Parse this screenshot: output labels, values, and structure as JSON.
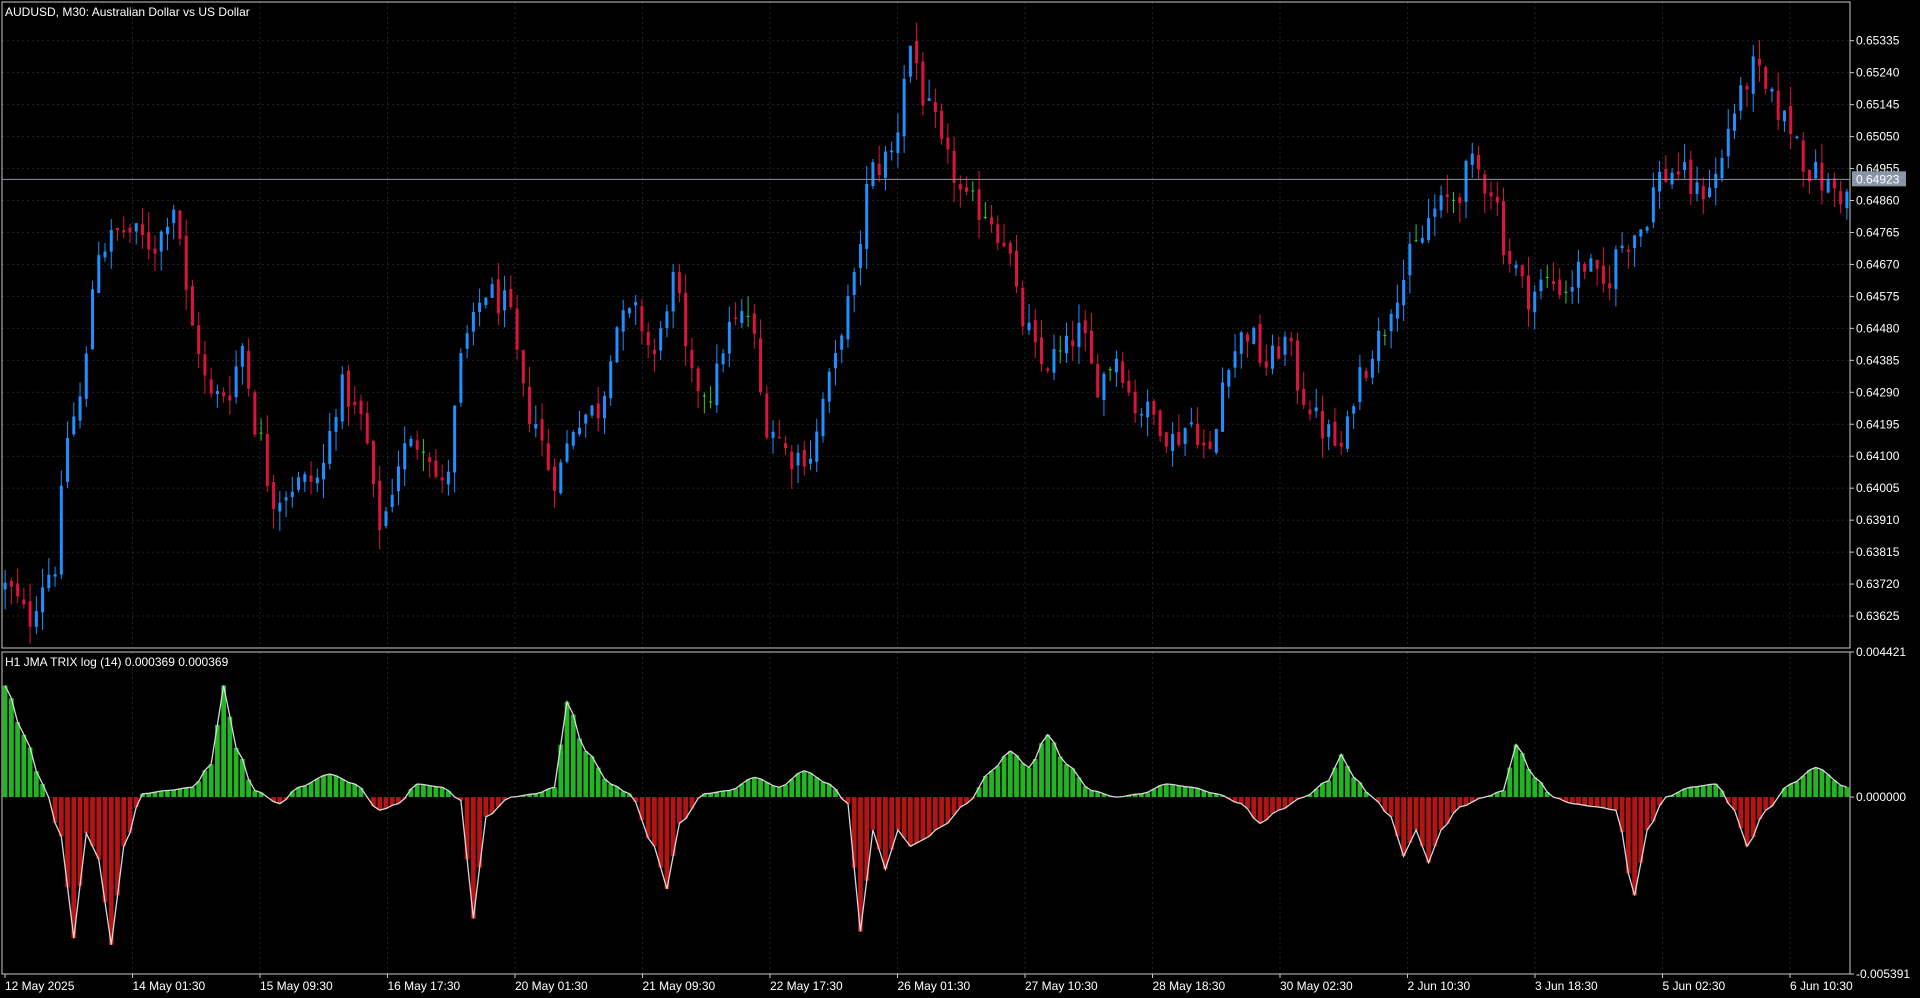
{
  "symbol_title": "AUDUSD, M30:  Australian Dollar vs US Dollar",
  "indicator_title": "H1 JMA TRIX log (14) 0.000369 0.000369",
  "current_price_label": "0.64923",
  "colors": {
    "background": "#000000",
    "frame": "#c8c8c8",
    "grid": "#1e2230",
    "bull_candle": "#1e90ff",
    "bear_candle": "#dc143c",
    "neutral_candle": "#32cd32",
    "trix_positive": "#22b422",
    "trix_negative": "#b41414",
    "trix_line": "#d8d8d8",
    "price_line": "#8a95a8",
    "price_tag_bg": "#8a95a8"
  },
  "chart_data": [
    {
      "type": "candlestick",
      "title": "AUDUSD, M30:  Australian Dollar vs US Dollar",
      "y_ticks": [
        "0.65335",
        "0.65240",
        "0.65145",
        "0.65050",
        "0.64955",
        "0.64860",
        "0.64765",
        "0.64670",
        "0.64575",
        "0.64480",
        "0.64385",
        "0.64290",
        "0.64195",
        "0.64100",
        "0.64005",
        "0.63910",
        "0.63815",
        "0.63720",
        "0.63625"
      ],
      "ylim": [
        0.6353,
        0.6545
      ],
      "current_price": 0.64923,
      "series": [
        {
          "name": "close",
          "waypoints": [
            [
              0,
              0.6371
            ],
            [
              4,
              0.6362
            ],
            [
              6,
              0.6373
            ],
            [
              8,
              0.6378
            ],
            [
              10,
              0.6416
            ],
            [
              12,
              0.6427
            ],
            [
              15,
              0.6472
            ],
            [
              19,
              0.6477
            ],
            [
              24,
              0.6473
            ],
            [
              27,
              0.6485
            ],
            [
              30,
              0.6448
            ],
            [
              33,
              0.6427
            ],
            [
              36,
              0.643
            ],
            [
              38,
              0.6443
            ],
            [
              40,
              0.642
            ],
            [
              43,
              0.6398
            ],
            [
              47,
              0.6402
            ],
            [
              50,
              0.6403
            ],
            [
              54,
              0.643
            ],
            [
              57,
              0.6421
            ],
            [
              60,
              0.639
            ],
            [
              64,
              0.6412
            ],
            [
              67,
              0.6415
            ],
            [
              70,
              0.64
            ],
            [
              74,
              0.6445
            ],
            [
              77,
              0.6459
            ],
            [
              80,
              0.6455
            ],
            [
              84,
              0.6423
            ],
            [
              88,
              0.6404
            ],
            [
              92,
              0.6422
            ],
            [
              95,
              0.6424
            ],
            [
              98,
              0.6449
            ],
            [
              101,
              0.6452
            ],
            [
              104,
              0.644
            ],
            [
              107,
              0.6462
            ],
            [
              110,
              0.6432
            ],
            [
              113,
              0.6429
            ],
            [
              116,
              0.6448
            ],
            [
              119,
              0.6452
            ],
            [
              122,
              0.642
            ],
            [
              126,
              0.641
            ],
            [
              129,
              0.6411
            ],
            [
              132,
              0.6432
            ],
            [
              135,
              0.6455
            ],
            [
              139,
              0.6495
            ],
            [
              142,
              0.65
            ],
            [
              145,
              0.6532
            ],
            [
              148,
              0.6512
            ],
            [
              151,
              0.6497
            ],
            [
              154,
              0.6485
            ],
            [
              157,
              0.6483
            ],
            [
              160,
              0.6475
            ],
            [
              163,
              0.645
            ],
            [
              166,
              0.6437
            ],
            [
              169,
              0.644
            ],
            [
              172,
              0.6447
            ],
            [
              175,
              0.6432
            ],
            [
              178,
              0.644
            ],
            [
              181,
              0.6425
            ],
            [
              184,
              0.6422
            ],
            [
              187,
              0.6415
            ],
            [
              190,
              0.642
            ],
            [
              193,
              0.641
            ],
            [
              196,
              0.644
            ],
            [
              199,
              0.6447
            ],
            [
              202,
              0.6437
            ],
            [
              205,
              0.6444
            ],
            [
              208,
              0.6428
            ],
            [
              211,
              0.6418
            ],
            [
              214,
              0.6412
            ],
            [
              217,
              0.6435
            ],
            [
              220,
              0.6445
            ],
            [
              223,
              0.646
            ],
            [
              226,
              0.6472
            ],
            [
              229,
              0.6483
            ],
            [
              232,
              0.6487
            ],
            [
              235,
              0.6496
            ],
            [
              238,
              0.649
            ],
            [
              241,
              0.6468
            ],
            [
              244,
              0.6458
            ],
            [
              247,
              0.6462
            ],
            [
              250,
              0.646
            ],
            [
              253,
              0.6467
            ],
            [
              256,
              0.646
            ],
            [
              259,
              0.6473
            ],
            [
              262,
              0.6478
            ],
            [
              265,
              0.6493
            ],
            [
              268,
              0.6495
            ],
            [
              271,
              0.6488
            ],
            [
              274,
              0.6493
            ],
            [
              277,
              0.6513
            ],
            [
              280,
              0.6525
            ],
            [
              283,
              0.6515
            ],
            [
              286,
              0.6508
            ],
            [
              289,
              0.6495
            ],
            [
              292,
              0.649
            ],
            [
              295,
              0.6487
            ]
          ]
        }
      ]
    },
    {
      "type": "histogram",
      "title": "H1 JMA TRIX log (14) 0.000369 0.000369",
      "y_ticks": [
        "0.004421",
        "0.000000",
        "-0.005391"
      ],
      "ylim": [
        -0.005391,
        0.004421
      ],
      "series": [
        {
          "name": "H1 JMA TRIX log (14)",
          "waypoints": [
            [
              0,
              0.0034
            ],
            [
              3,
              0.0019
            ],
            [
              6,
              0.0004
            ],
            [
              9,
              -0.0012
            ],
            [
              11,
              -0.0043
            ],
            [
              13,
              -0.0011
            ],
            [
              15,
              -0.0019
            ],
            [
              17,
              -0.0045
            ],
            [
              19,
              -0.0015
            ],
            [
              22,
              0.0001
            ],
            [
              26,
              0.0002
            ],
            [
              30,
              0.0003
            ],
            [
              33,
              0.001
            ],
            [
              35,
              0.0034
            ],
            [
              37,
              0.0015
            ],
            [
              40,
              0.0002
            ],
            [
              44,
              -0.0002
            ],
            [
              47,
              0.0003
            ],
            [
              52,
              0.0007
            ],
            [
              56,
              0.0004
            ],
            [
              60,
              -0.0004
            ],
            [
              63,
              -0.0002
            ],
            [
              66,
              0.0004
            ],
            [
              70,
              0.0003
            ],
            [
              73,
              -0.0001
            ],
            [
              75,
              -0.0037
            ],
            [
              77,
              -0.0006
            ],
            [
              81,
              0.0
            ],
            [
              85,
              0.0001
            ],
            [
              88,
              0.0003
            ],
            [
              90,
              0.0029
            ],
            [
              93,
              0.0014
            ],
            [
              97,
              0.0004
            ],
            [
              100,
              0.0001
            ],
            [
              104,
              -0.0015
            ],
            [
              106,
              -0.0028
            ],
            [
              108,
              -0.0008
            ],
            [
              112,
              0.0001
            ],
            [
              116,
              0.0002
            ],
            [
              120,
              0.0006
            ],
            [
              124,
              0.0003
            ],
            [
              128,
              0.0008
            ],
            [
              132,
              0.0004
            ],
            [
              135,
              -0.0002
            ],
            [
              137,
              -0.0041
            ],
            [
              139,
              -0.001
            ],
            [
              141,
              -0.0022
            ],
            [
              143,
              -0.001
            ],
            [
              145,
              -0.0015
            ],
            [
              147,
              -0.0013
            ],
            [
              150,
              -0.0009
            ],
            [
              154,
              -0.0002
            ],
            [
              158,
              0.0008
            ],
            [
              161,
              0.0014
            ],
            [
              164,
              0.0009
            ],
            [
              167,
              0.0019
            ],
            [
              170,
              0.001
            ],
            [
              174,
              0.0002
            ],
            [
              178,
              0.0
            ],
            [
              182,
              0.0001
            ],
            [
              186,
              0.0004
            ],
            [
              190,
              0.0003
            ],
            [
              194,
              0.0001
            ],
            [
              198,
              -0.0002
            ],
            [
              201,
              -0.0008
            ],
            [
              204,
              -0.0004
            ],
            [
              208,
              0.0
            ],
            [
              212,
              0.0005
            ],
            [
              214,
              0.0013
            ],
            [
              216,
              0.0006
            ],
            [
              219,
              0.0
            ],
            [
              222,
              -0.0006
            ],
            [
              224,
              -0.0018
            ],
            [
              226,
              -0.001
            ],
            [
              228,
              -0.002
            ],
            [
              230,
              -0.001
            ],
            [
              233,
              -0.0003
            ],
            [
              237,
              0.0
            ],
            [
              240,
              0.0002
            ],
            [
              242,
              0.0016
            ],
            [
              245,
              0.0006
            ],
            [
              248,
              0.0
            ],
            [
              251,
              -0.0002
            ],
            [
              255,
              -0.0003
            ],
            [
              258,
              -0.0004
            ],
            [
              261,
              -0.003
            ],
            [
              263,
              -0.001
            ],
            [
              266,
              0.0
            ],
            [
              270,
              0.0003
            ],
            [
              274,
              0.0004
            ],
            [
              277,
              -0.0004
            ],
            [
              279,
              -0.0015
            ],
            [
              282,
              -0.0004
            ],
            [
              286,
              0.0004
            ],
            [
              290,
              0.0009
            ],
            [
              295,
              0.0003
            ]
          ]
        }
      ]
    }
  ],
  "x_labels": [
    "12 May 2025",
    "14 May 01:30",
    "15 May 09:30",
    "16 May 17:30",
    "20 May 01:30",
    "21 May 09:30",
    "22 May 17:30",
    "26 May 01:30",
    "27 May 10:30",
    "28 May 18:30",
    "30 May 02:30",
    "2 Jun 10:30",
    "3 Jun 18:30",
    "5 Jun 02:30",
    "6 Jun 10:30"
  ]
}
